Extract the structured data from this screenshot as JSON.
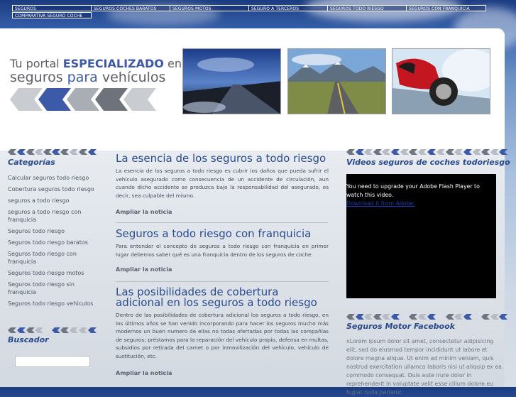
{
  "nav": {
    "items": [
      {
        "label": "SEGUROS"
      },
      {
        "label": "SEGUROS COCHES BARATOS"
      },
      {
        "label": "SEGUROS MOTOS"
      },
      {
        "label": "SEGURO A TERCEROS"
      },
      {
        "label": "SEGUROS TODO RIESGO"
      },
      {
        "label": "SEGUROS CON FRANQUICIA"
      },
      {
        "label": "COMPARATIVA SEGURO COCHE"
      }
    ]
  },
  "banner": {
    "tagline_line1_prefix": "Tu portal ",
    "tagline_line1_highlight": "ESPECIALIZADO",
    "tagline_line1_suffix": " en",
    "tagline_line2_prefix": "seguros ",
    "tagline_line2_highlight": "para",
    "tagline_line2_suffix": " vehículos",
    "photos": [
      "car-dashboard-road-photo",
      "highway-mountains-photo",
      "motorcycle-rider-photo"
    ]
  },
  "sidebar": {
    "categories_title": "Categorías",
    "categories": [
      "Calcular seguros todo riesgo",
      "Cobertura seguros todo riesgo",
      "seguros a todo riesgo",
      "seguros a todo riesgo con franquicia",
      "Seguros todo riesgo",
      "Seguros todo riesgo baratos",
      "Seguros todo riesgo con franquicia",
      "Seguros todo riesgo motos",
      "Seguros todo riesgo sin franquicia",
      "Seguros todo riesgo vehiculos"
    ],
    "search_title": "Buscador",
    "search_value": ""
  },
  "articles": [
    {
      "title": "La esencia de los seguros a todo riesgo",
      "body": "La esencia de los seguros a todo riesgo es cubrir los daños que pueda sufrir el vehículo asegurado como consecuencia de un accidente de circulación, aun cuando dicho accidente se produzca bajo la responsabilidad del asegurado, es decir, sea culpable del mismo.",
      "more": "Ampliar la noticia"
    },
    {
      "title": "Seguros a todo riesgo con franquicia",
      "body": "Para entender el concepto de seguros a todo riesgo con franquicia en primer lugar debemos saber qué es una franquicia dentro de los seguros de coche.",
      "more": "Ampliar la noticia"
    },
    {
      "title": "Las posibilidades de cobertura adicional en los seguros a todo riesgo",
      "body": "Dentro de las posibilidades de cobertura adicional los seguros a todo riesgo, en los últimos años se han venido incorporando para hacer los seguros mucho más modernos un buen numero de ellas no todas ofertadas por todas las compañías de seguros; préstamos para la reparación del vehículo propio, defensa en multas, subsidios por retirada del carnet o por inmovilización del vehículo, vehículo de sustitución, etc.",
      "more": "Ampliar la noticia"
    }
  ],
  "right": {
    "videos_title": "Videos seguros de coches todoriesgo",
    "flash_message": "You need to upgrade your Adobe Flash Player to watch this video.",
    "flash_link": "Download it from Adobe.",
    "facebook_title": "Seguros Motor Facebook",
    "facebook_text": "xLorem ipsum dolor sit amet, consectetur adipisicing elit, sed do eiusmod tempor incididunt ut labore et dolore magna aliqua. Ut enim ad minim veniam, quis nostrud exercitation ullamco laboris nisi ut aliquip ex ea commodo consequat. Duis aute irure dolor in reprehenderit in voluptate velit esse cillum dolore eu fugiat nulla pariatur."
  },
  "colors": {
    "accent": "#2a4a8e",
    "nav_bg": "#1b3c82",
    "video_bg": "#000000"
  }
}
